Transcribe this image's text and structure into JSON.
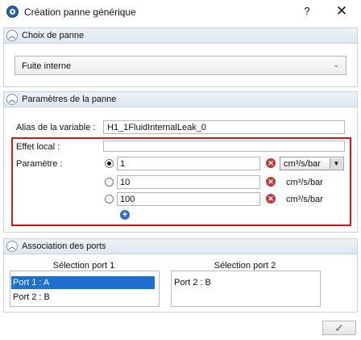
{
  "window": {
    "title": "Création panne générique",
    "help": "?",
    "close": "✕"
  },
  "fault_choice": {
    "header": "Choix de panne",
    "selected": "Fuite interne"
  },
  "params": {
    "header": "Paramètres de la panne",
    "alias_label": "Alias de la variable :",
    "alias_value": "H1_1FluidInternalLeak_0",
    "effet_label": "Effet local :",
    "effet_value": "",
    "param_label": "Paramètre :",
    "rows": [
      {
        "value": "1",
        "unit": "cm³/s/bar",
        "selected": true
      },
      {
        "value": "10",
        "unit": "cm³/s/bar",
        "selected": false
      },
      {
        "value": "100",
        "unit": "cm³/s/bar",
        "selected": false
      }
    ]
  },
  "ports": {
    "header": "Association des ports",
    "col1_title": "Sélection port 1",
    "col2_title": "Sélection port 2",
    "list1": [
      "Port 1 : A",
      "Port 2 : B"
    ],
    "list1_selected": "Port 1 : A",
    "list2": [
      "Port 2 : B"
    ]
  },
  "footer": {
    "ok": "✓"
  },
  "colors": {
    "accent": "#1d6fd1",
    "highlight_border": "#d01818",
    "delete_icon": "#c23a3a",
    "add_icon": "#2d6fc8"
  },
  "icons": {
    "app": "app-logo-icon",
    "collapse": "chevron-up-icon",
    "delete": "delete-icon",
    "add": "add-icon",
    "check": "check-icon"
  }
}
